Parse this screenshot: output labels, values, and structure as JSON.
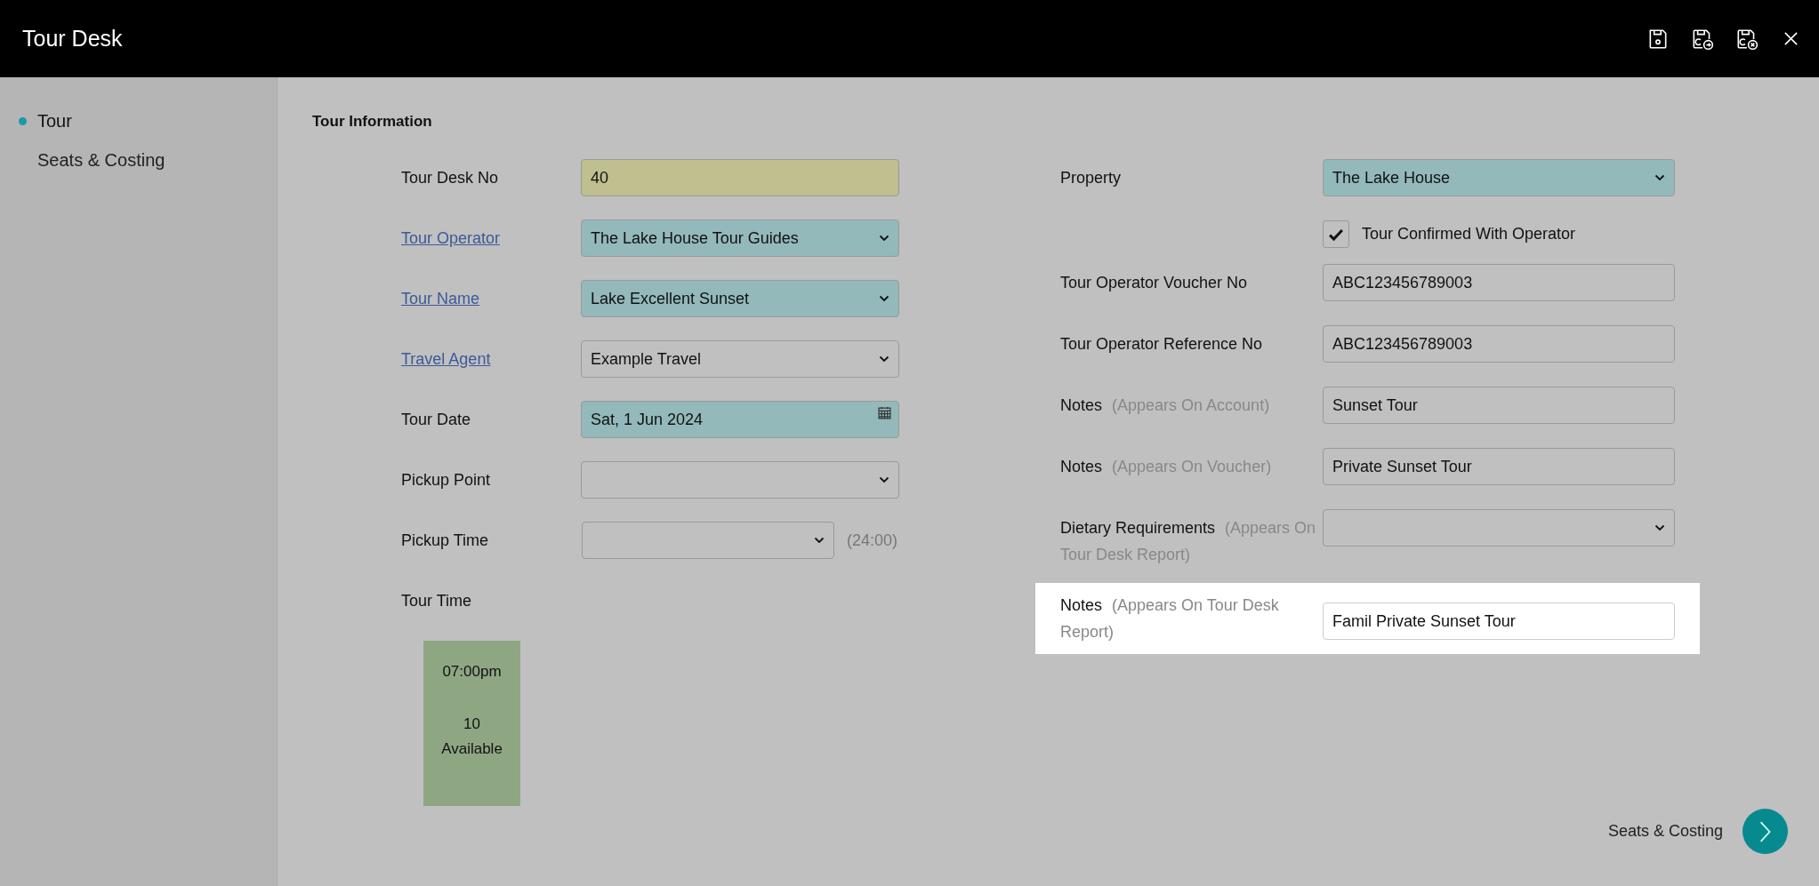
{
  "window": {
    "title": "Tour Desk"
  },
  "toolbar": [
    {
      "kind": "save"
    },
    {
      "kind": "save-continue"
    },
    {
      "kind": "save-cancel"
    },
    {
      "kind": "close"
    }
  ],
  "sidebar": {
    "items": [
      {
        "label": "Tour",
        "selected": true
      },
      {
        "label": "Seats & Costing",
        "selected": false
      }
    ]
  },
  "section_title": "Tour Information",
  "left_fields": [
    {
      "label": "Tour Desk No",
      "link": false,
      "kind": "text",
      "value": "40",
      "color": "#bfbf8f"
    },
    {
      "label": "Tour Operator",
      "link": true,
      "kind": "select",
      "value": "The Lake House Tour Guides",
      "color": "#93b9bb"
    },
    {
      "label": "Tour Name",
      "link": true,
      "kind": "select",
      "value": "Lake Excellent Sunset",
      "color": "#93b9bb"
    },
    {
      "label": "Travel Agent",
      "link": true,
      "kind": "select",
      "value": "Example Travel"
    },
    {
      "label": "Tour Date",
      "link": false,
      "kind": "date",
      "value": "Sat, 1 Jun 2024",
      "color": "#93b9bb"
    },
    {
      "label": "Pickup Point",
      "link": false,
      "kind": "select"
    },
    {
      "label": "Pickup Time",
      "link": false,
      "kind": "select",
      "hint": "(24:00)"
    }
  ],
  "tour_time": {
    "label": "Tour Time",
    "slots": [
      {
        "time": "07:00pm",
        "count": "10",
        "status": "Available",
        "color": "#8fa683"
      }
    ]
  },
  "right_fields": [
    {
      "label": "Property",
      "kind": "select",
      "value": "The Lake House",
      "color": "#93b9bb",
      "highlighted": false
    },
    {
      "label": "Tour Confirmed With Operator",
      "kind": "checkbox",
      "checked": true,
      "highlighted": false
    },
    {
      "label": "Tour Operator Voucher No",
      "kind": "text",
      "value": "ABC123456789003",
      "highlighted": false
    },
    {
      "label": "Tour Operator Reference No",
      "kind": "text",
      "value": "ABC123456789003",
      "highlighted": false
    },
    {
      "label": "Notes",
      "note": "(Appears On Account)",
      "kind": "text",
      "value": "Sunset Tour",
      "highlighted": false
    },
    {
      "label": "Notes",
      "note": "(Appears On Voucher)",
      "kind": "text",
      "value": "Private Sunset Tour",
      "highlighted": false
    },
    {
      "label": "Dietary Requirements",
      "note": "(Appears On Tour Desk Report)",
      "kind": "select",
      "highlighted": false
    },
    {
      "label": "Notes",
      "note": "(Appears On Tour Desk Report)",
      "kind": "text",
      "value": "Famil Private Sunset Tour",
      "highlighted": true
    }
  ],
  "next_button": {
    "label": "Seats & Costing"
  }
}
